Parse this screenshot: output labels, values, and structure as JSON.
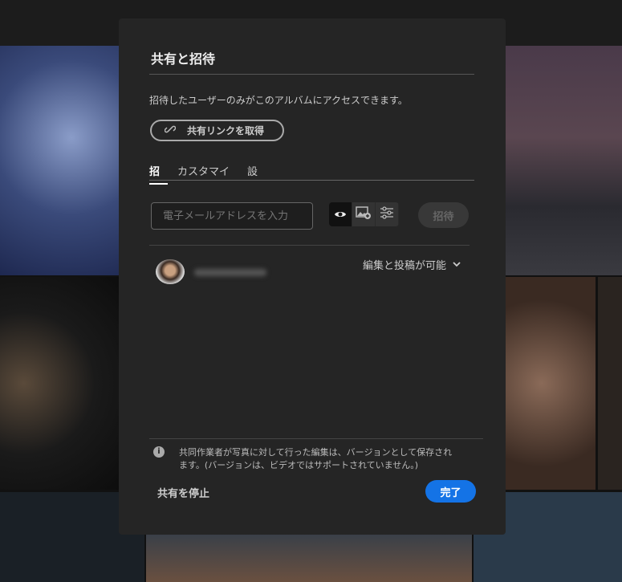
{
  "dialog": {
    "title": "共有と招待",
    "description": "招待したユーザーのみがこのアルバムにアクセスできます。",
    "get_link_label": "共有リンクを取得",
    "tabs": [
      {
        "label": "招"
      },
      {
        "label": "カスタマイ"
      },
      {
        "label": "設"
      }
    ],
    "email_placeholder": "電子メールアドレスを入力",
    "invite_label": "招待",
    "permission_label": "編集と投稿が可能",
    "note": "共同作業者が写真に対して行った編集は、バージョンとして保存されます。(バージョンは、ビデオではサポートされていません。)",
    "info_glyph": "i",
    "stop_sharing_label": "共有を停止",
    "done_label": "完了"
  },
  "colors": {
    "accent": "#1473e6",
    "dialog_bg": "#252525"
  }
}
